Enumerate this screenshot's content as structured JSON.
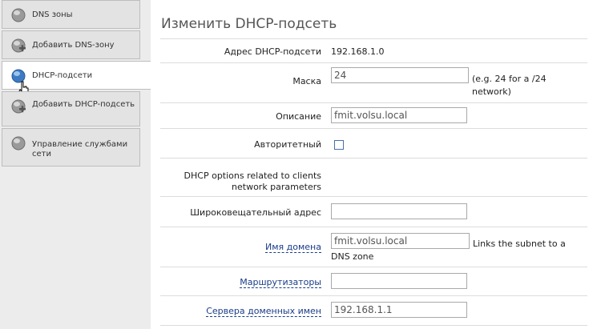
{
  "sidebar": {
    "items": [
      {
        "label": "DNS зоны"
      },
      {
        "label": "Добавить DNS-зону"
      },
      {
        "label": "DHCP-подсети"
      },
      {
        "label": "Добавить DHCP-подсеть"
      },
      {
        "label": "Управление службами сети"
      }
    ],
    "active_index": 2
  },
  "page": {
    "title": "Изменить DHCP-подсеть"
  },
  "form": {
    "subnet_address": {
      "label": "Адрес DHCP-подсети",
      "value": "192.168.1.0"
    },
    "mask": {
      "label": "Маска",
      "value": "24",
      "hint": "(e.g. 24 for a /24 network)"
    },
    "description": {
      "label": "Описание",
      "value": "fmit.volsu.local"
    },
    "authoritative": {
      "label": "Авторитетный",
      "checked": false
    },
    "dhcp_options_header": "DHCP options related to clients network parameters",
    "broadcast": {
      "label": "Широковещательный адрес",
      "value": ""
    },
    "domain_name": {
      "label": "Имя домена",
      "value": "fmit.volsu.local",
      "hint": "Links the subnet to a DNS zone"
    },
    "routers": {
      "label": "Маршрутизаторы",
      "value": ""
    },
    "dns_servers": {
      "label": "Сервера доменных имен",
      "value": "192.168.1.1"
    }
  },
  "colors": {
    "link": "#1a3c8a",
    "sidebar_bg": "#ececec",
    "icon_globe": "#3c7bc4"
  }
}
